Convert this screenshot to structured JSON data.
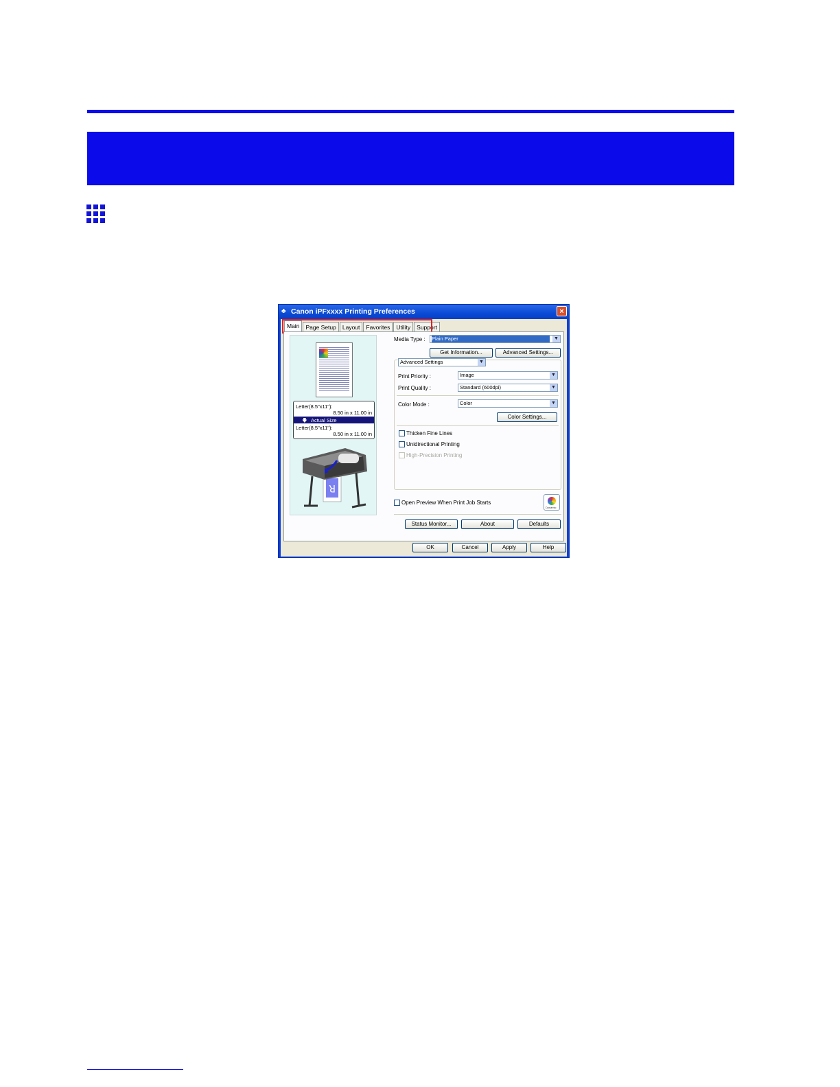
{
  "dialog": {
    "title": "Canon iPFxxxx Printing Preferences",
    "close_glyph": "×",
    "tabs": [
      {
        "label": "Main"
      },
      {
        "label": "Page Setup"
      },
      {
        "label": "Layout"
      },
      {
        "label": "Favorites"
      },
      {
        "label": "Utility"
      },
      {
        "label": "Support"
      }
    ],
    "preview": {
      "paper_line1": "Letter(8.5\"x11\"):",
      "paper_line1_size": "8.50 in x 11.00 in",
      "scale_label": "Actual Size",
      "paper_line2": "Letter(8.5\"x11\"):",
      "paper_line2_size": "8.50 in x 11.00 in"
    },
    "media_type": {
      "label": "Media Type :",
      "value": "Plain Paper"
    },
    "get_information_label": "Get Information...",
    "advanced_settings_btn_label": "Advanced Settings...",
    "mode_combo_value": "Advanced Settings",
    "print_priority": {
      "label": "Print Priority :",
      "value": "Image"
    },
    "print_quality": {
      "label": "Print Quality :",
      "value": "Standard (600dpi)"
    },
    "color_mode": {
      "label": "Color Mode :",
      "value": "Color"
    },
    "color_settings_label": "Color Settings...",
    "checkboxes": [
      {
        "label": "Thicken Fine Lines",
        "enabled": true
      },
      {
        "label": "Unidirectional Printing",
        "enabled": true
      },
      {
        "label": "High-Precision Printing",
        "enabled": false
      }
    ],
    "open_preview_label": "Open Preview When Print Job Starts",
    "eco_label": "Dynamic",
    "status_monitor_label": "Status Monitor...",
    "about_label": "About",
    "defaults_label": "Defaults",
    "ok_label": "OK",
    "cancel_label": "Cancel",
    "apply_label": "Apply",
    "help_label": "Help"
  }
}
